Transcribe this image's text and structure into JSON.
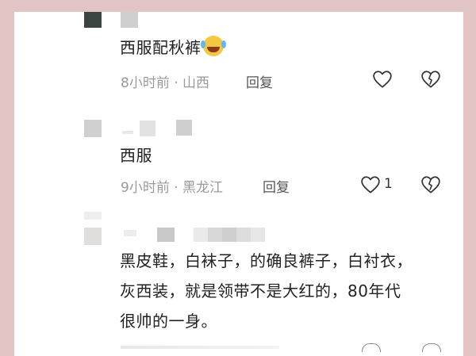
{
  "comments": [
    {
      "text": "西服配秋裤",
      "emoji": "laughing-crying-emoji-icon",
      "meta": "8小时前 · 山西",
      "reply": "回复"
    },
    {
      "text": "西服",
      "meta": "9小时前 · 黑龙江",
      "reply": "回复",
      "likes": "1"
    },
    {
      "lines": [
        "黑皮鞋，白袜子，的确良裤子，白衬衣，",
        "灰西装，就是领带不是大红的，80年代",
        "很帅的一身。"
      ]
    }
  ],
  "colors": {
    "page_background": "#e2c4c5",
    "card_background": "#ffffff",
    "meta_text": "#9a9a9a"
  }
}
